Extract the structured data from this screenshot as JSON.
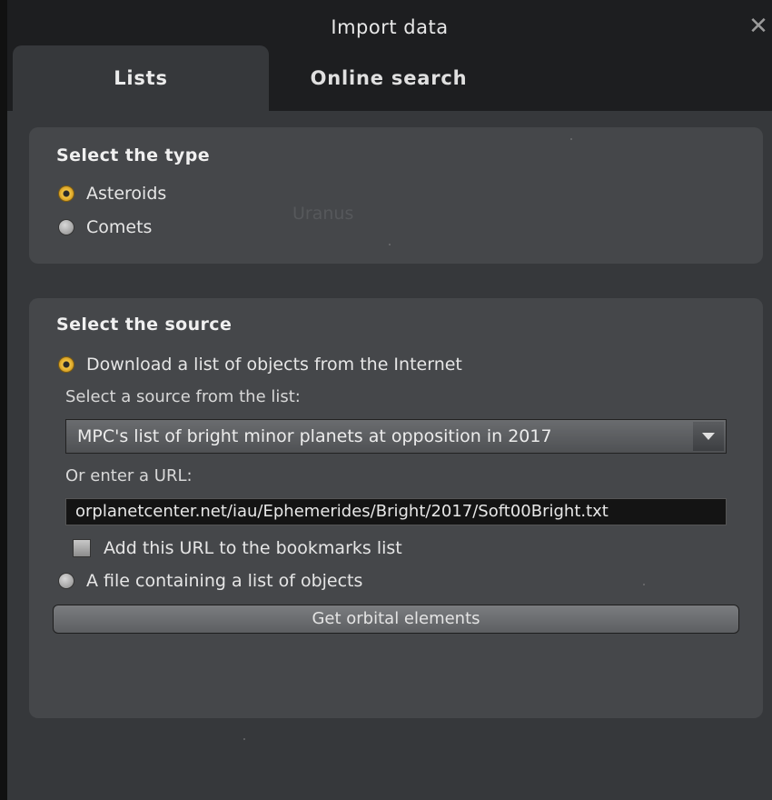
{
  "window": {
    "title": "Import data",
    "close_glyph": "✕"
  },
  "tabs": [
    {
      "label": "Lists",
      "active": true
    },
    {
      "label": "Online search",
      "active": false
    }
  ],
  "type_panel": {
    "title": "Select the type",
    "options": [
      {
        "label": "Asteroids",
        "checked": true
      },
      {
        "label": "Comets",
        "checked": false
      }
    ],
    "background_label": "Uranus"
  },
  "source_panel": {
    "title": "Select the source",
    "download_option": {
      "label": "Download a list of objects from the Internet",
      "checked": true
    },
    "list_label": "Select a source from the list:",
    "selected_source": "MPC's list of bright minor planets at opposition in 2017",
    "url_label": "Or enter a URL:",
    "url_value": "orplanetcenter.net/iau/Ephemerides/Bright/2017/Soft00Bright.txt",
    "bookmark_checkbox": {
      "label": "Add this URL to the bookmarks list",
      "checked": false
    },
    "file_option": {
      "label": "A file containing a list of objects",
      "checked": false
    },
    "action_button": "Get orbital elements"
  },
  "colors": {
    "accent_radio": "#f5c542",
    "panel_bg": "#45474a",
    "titlebar_bg": "#1d1e20"
  },
  "icons": {
    "close": "close-icon",
    "dropdown": "chevron-down-icon"
  }
}
